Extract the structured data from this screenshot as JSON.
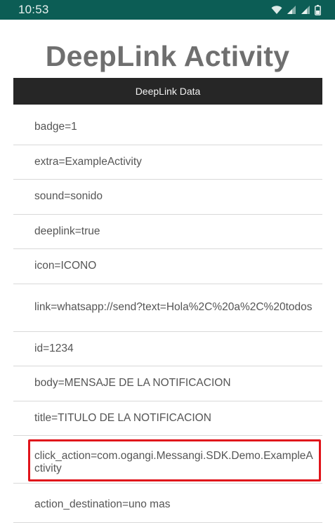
{
  "status_bar": {
    "time": "10:53",
    "icons": [
      "wifi-icon",
      "signal-icon",
      "signal-icon-2",
      "battery-icon"
    ],
    "background": "#0c5d55"
  },
  "app": {
    "title": "DeepLink Activity"
  },
  "section": {
    "header": "DeepLink Data"
  },
  "items": [
    {
      "text": "badge=1",
      "highlighted": false
    },
    {
      "text": "extra=ExampleActivity",
      "highlighted": false
    },
    {
      "text": "sound=sonido",
      "highlighted": false
    },
    {
      "text": "deeplink=true",
      "highlighted": false
    },
    {
      "text": "icon=ICONO",
      "highlighted": false
    },
    {
      "text": "link=whatsapp://send?text=Hola%2C%20a%2C%20todos",
      "highlighted": false
    },
    {
      "text": "id=1234",
      "highlighted": false
    },
    {
      "text": "body=MENSAJE DE LA NOTIFICACION",
      "highlighted": false
    },
    {
      "text": "title=TITULO DE LA NOTIFICACION",
      "highlighted": false
    },
    {
      "text": "click_action=com.ogangi.Messangi.SDK.Demo.ExampleActivity",
      "highlighted": true
    },
    {
      "text": "action_destination=uno mas",
      "highlighted": false
    }
  ],
  "colors": {
    "highlight_border": "#e0141b",
    "header_background": "#262626",
    "title_text": "#6f6f6f"
  }
}
